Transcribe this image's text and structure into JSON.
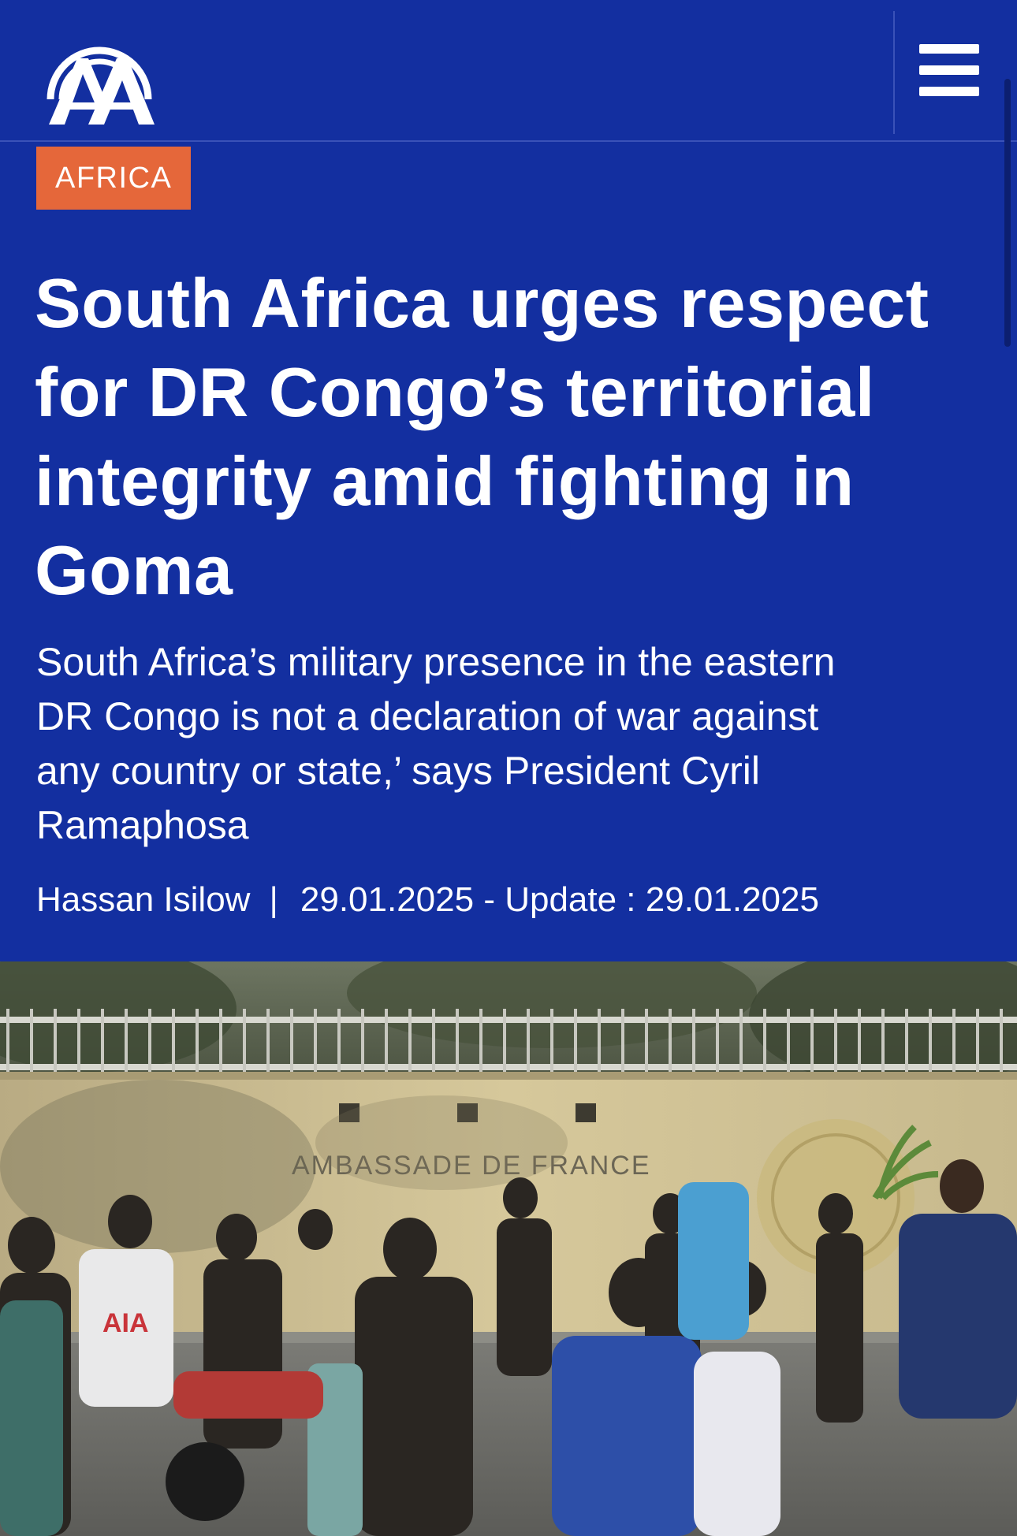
{
  "header": {
    "logo_text": "AA",
    "logo_icon": "aa-logo-icon",
    "menu_icon": "hamburger-menu-icon"
  },
  "article": {
    "category": "AFRICA",
    "headline": "South Africa urges respect for DR Congo’s territorial integrity amid fighting in Goma",
    "summary": "South Africa’s military presence in the eastern DR Congo is not a declaration of war against any country or state,’ says President Cyril Ramaphosa",
    "author": "Hassan Isilow",
    "separator": "|",
    "dateline": "29.01.2025 - Update : 29.01.2025"
  },
  "photo": {
    "wall_sign": "AMBASSADE DE FRANCE",
    "shirt_text": "AIA"
  },
  "colors": {
    "brand_blue": "#132fa0",
    "category_orange": "#e5673a",
    "text": "#ffffff"
  }
}
